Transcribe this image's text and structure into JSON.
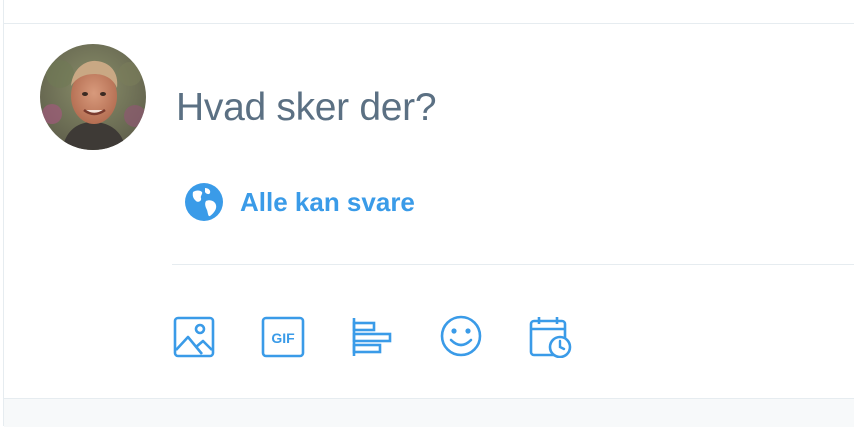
{
  "compose": {
    "placeholder": "Hvad sker der?",
    "reply_setting_label": "Alle kan svare"
  },
  "icons": {
    "reply_setting": "globe-icon",
    "toolbar": [
      "image-icon",
      "gif-icon",
      "poll-icon",
      "emoji-icon",
      "schedule-icon"
    ]
  },
  "toolbar": {
    "gif_text": "GIF"
  },
  "colors": {
    "accent": "#3a9be8",
    "placeholder_text": "#5b7083",
    "divider": "#e6ecf0"
  }
}
